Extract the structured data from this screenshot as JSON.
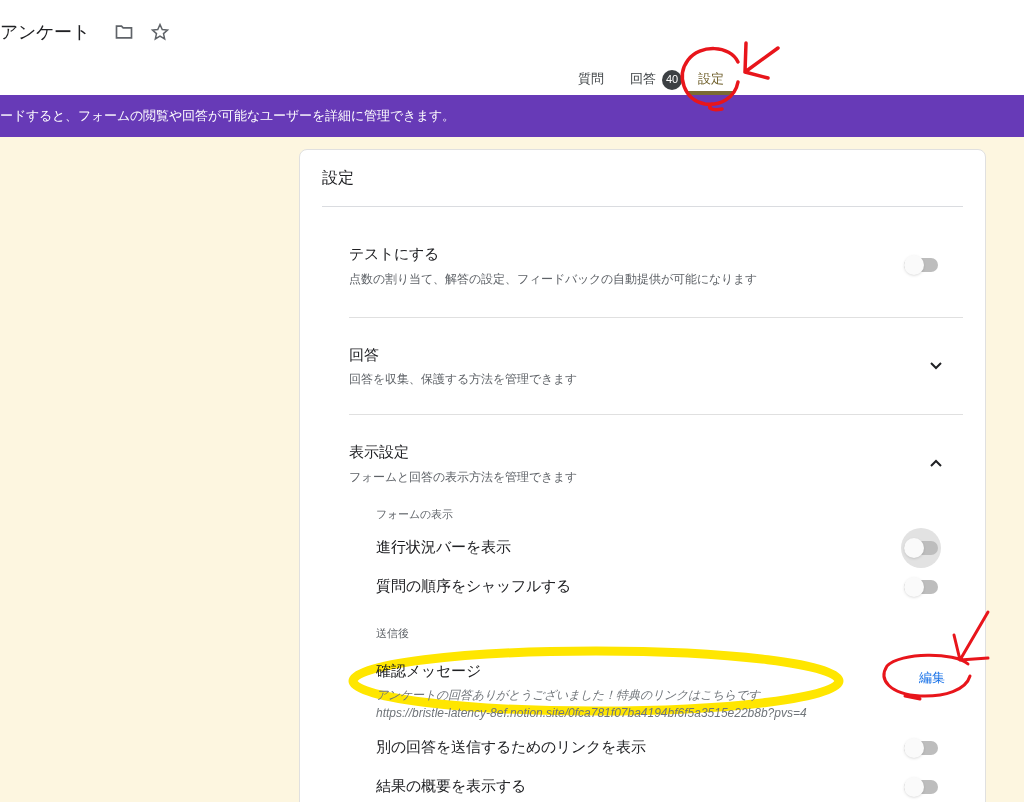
{
  "header": {
    "title": "アンケート"
  },
  "tabs": [
    {
      "label": "質問",
      "selected": false
    },
    {
      "label": "回答",
      "badge": "40",
      "selected": false
    },
    {
      "label": "設定",
      "selected": true
    }
  ],
  "banner": {
    "text": "ードすると、フォームの閲覧や回答が可能なユーザーを詳細に管理できます。"
  },
  "settings": {
    "title": "設定",
    "sections": [
      {
        "kind": "toggle",
        "title": "テストにする",
        "description": "点数の割り当て、解答の設定、フィードバックの自動提供が可能になります",
        "on": false
      },
      {
        "kind": "expandable",
        "title": "回答",
        "description": "回答を収集、保護する方法を管理できます",
        "expanded": false
      },
      {
        "kind": "expandable",
        "title": "表示設定",
        "description": "フォームと回答の表示方法を管理できます",
        "expanded": true,
        "groups": [
          {
            "heading": "フォームの表示",
            "items": [
              {
                "kind": "toggle",
                "label": "進行状況バーを表示",
                "on": false,
                "focused": true
              },
              {
                "kind": "toggle",
                "label": "質問の順序をシャッフルする",
                "on": false,
                "focused": false
              }
            ]
          },
          {
            "heading": "送信後",
            "items": [
              {
                "kind": "message",
                "label": "確認メッセージ",
                "message": "アンケートの回答ありがとうございました！特典のリンクはこちらです",
                "url": "https://bristle-latency-8ef.notion.site/0fca781f07ba4194bf6f5a3515e22b8b?pvs=4",
                "action": "編集"
              },
              {
                "kind": "toggle",
                "label": "別の回答を送信するためのリンクを表示",
                "on": false,
                "focused": false
              },
              {
                "kind": "toggle",
                "label": "結果の概要を表示する",
                "on": false,
                "focused": false
              }
            ]
          }
        ]
      }
    ]
  }
}
